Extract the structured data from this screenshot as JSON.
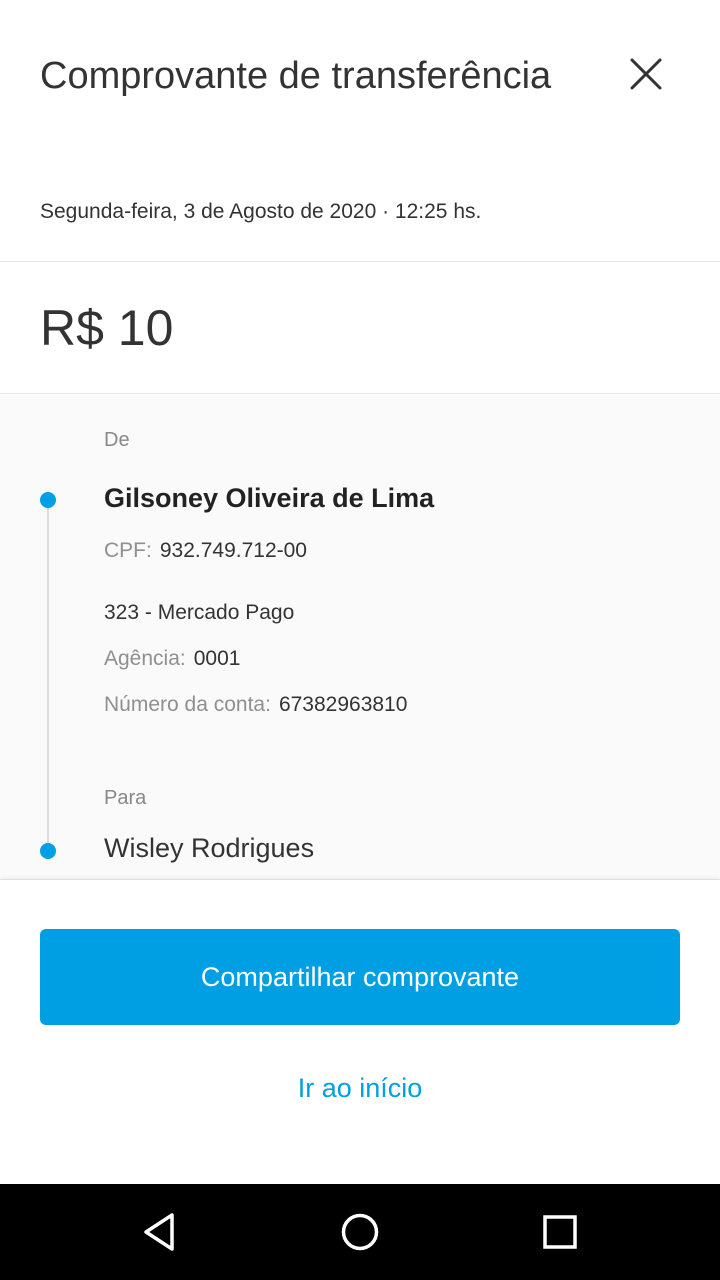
{
  "header": {
    "title": "Comprovante de transferência",
    "close_icon": "close-icon",
    "date": "Segunda-feira, 3 de Agosto de 2020 · 12:25 hs."
  },
  "amount": "R$ 10",
  "from": {
    "label": "De",
    "name": "Gilsoney Oliveira de Lima",
    "cpf_label": "CPF:",
    "cpf_value": "932.749.712-00",
    "bank": "323 - Mercado Pago",
    "agency_label": "Agência:",
    "agency_value": "0001",
    "account_label": "Número da conta:",
    "account_value": "67382963810"
  },
  "to": {
    "label": "Para",
    "name": "Wisley Rodrigues"
  },
  "actions": {
    "share_label": "Compartilhar comprovante",
    "home_label": "Ir ao início"
  },
  "nav": {
    "back_icon": "back-triangle-icon",
    "home_icon": "home-circle-icon",
    "recents_icon": "recents-square-icon"
  },
  "colors": {
    "accent": "#009ee3",
    "text": "#333333",
    "muted": "#888888"
  }
}
